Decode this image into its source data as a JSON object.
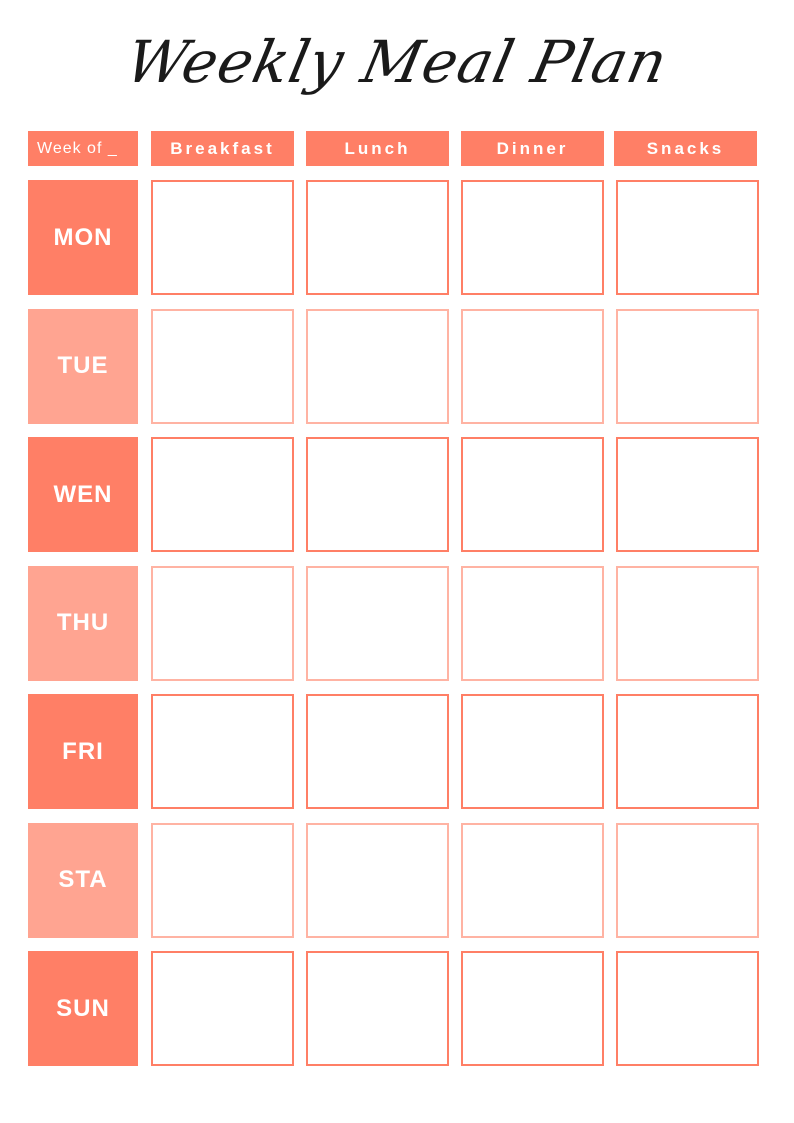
{
  "title": "Weekly Meal Plan",
  "header": {
    "week_of": "Week of _",
    "columns": [
      "Breakfast",
      "Lunch",
      "Dinner",
      "Snacks"
    ]
  },
  "days": [
    "MON",
    "TUE",
    "WEN",
    "THU",
    "FRI",
    "STA",
    "SUN"
  ],
  "colors": {
    "accent": "#ff7f66",
    "accent_light": "#ffa491",
    "title": "#1a1a1a"
  }
}
